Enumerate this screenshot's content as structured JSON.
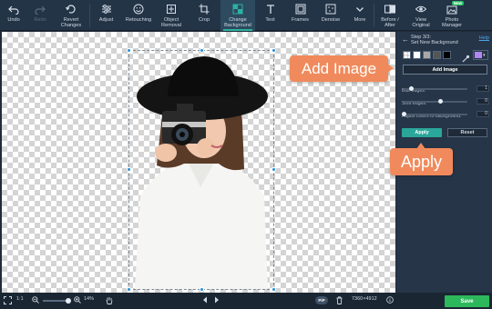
{
  "toolbar": {
    "undo": "Undo",
    "redo": "Redo",
    "revert": "Revert Changes",
    "adjust": "Adjust",
    "retouching": "Retouching",
    "object_removal": "Object Removal",
    "crop": "Crop",
    "change_background": "Change Background",
    "text": "Text",
    "frames": "Frames",
    "denoise": "Denoise",
    "more": "More",
    "before_after": "Before / After",
    "view_original": "View Original",
    "photo_manager": "Photo Manager",
    "new_badge": "New"
  },
  "panel": {
    "step": "Step 3/3:",
    "step_title": "Set New Background",
    "help": "Help",
    "add_image": "Add Image",
    "blur_label": "Blur edges:",
    "blur_value": "1",
    "shift_label": "Shift edges:",
    "shift_value": "0",
    "adjust_label": "Adjust colors to background:",
    "adjust_value": "0",
    "apply": "Apply",
    "reset": "Reset",
    "swatch_colors": [
      "transparent",
      "#ffffff",
      "#a8a8a8",
      "#555555",
      "#000000"
    ],
    "selected_color": "#b486f2"
  },
  "callouts": {
    "add_image": "Add Image",
    "apply": "Apply"
  },
  "status": {
    "fit": "1:1",
    "zoom": "14%",
    "pip": "PiP",
    "dimensions": "7360×4912",
    "save": "Save"
  }
}
